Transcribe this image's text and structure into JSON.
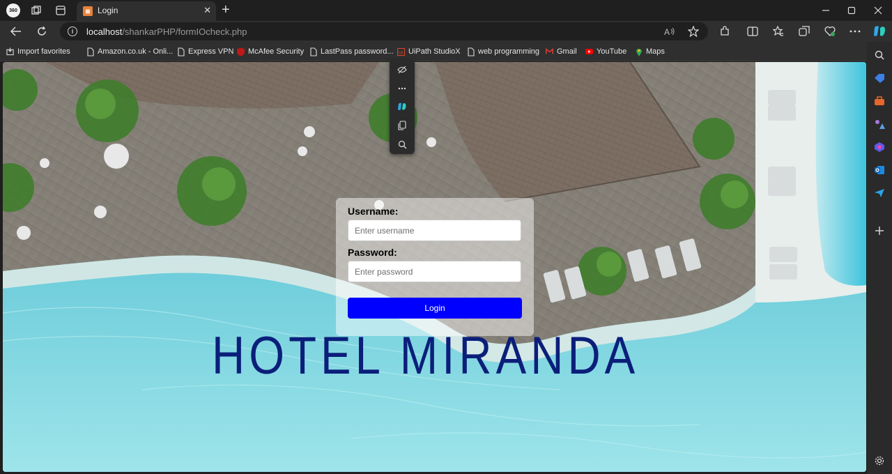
{
  "colors": {
    "login_button": "#0000ff",
    "hotel_title": "#0b1f7a",
    "browser_dark": "#1f1f1f",
    "browser_toolbar": "#2f2f2f"
  },
  "tab": {
    "title": "Login",
    "favicon": "xampp-icon"
  },
  "address": {
    "host": "localhost",
    "path": "/shankarPHP/formIOcheck.php"
  },
  "favorites": [
    {
      "label": "Import favorites",
      "icon": "import-icon"
    },
    {
      "label": "Amazon.co.uk - Onli...",
      "icon": "page-icon"
    },
    {
      "label": "Express VPN",
      "icon": "page-icon"
    },
    {
      "label": "McAfee Security",
      "icon": "mcafee-icon"
    },
    {
      "label": "LastPass password...",
      "icon": "page-icon"
    },
    {
      "label": "UiPath StudioX",
      "icon": "uipath-icon"
    },
    {
      "label": "web programming",
      "icon": "page-icon"
    },
    {
      "label": "Gmail",
      "icon": "gmail-icon"
    },
    {
      "label": "YouTube",
      "icon": "youtube-icon"
    },
    {
      "label": "Maps",
      "icon": "maps-icon"
    }
  ],
  "login": {
    "username_label": "Username:",
    "username_placeholder": "Enter username",
    "password_label": "Password:",
    "password_placeholder": "Enter password",
    "button": "Login"
  },
  "hero": {
    "title": "HOTEL MIRANDA"
  }
}
